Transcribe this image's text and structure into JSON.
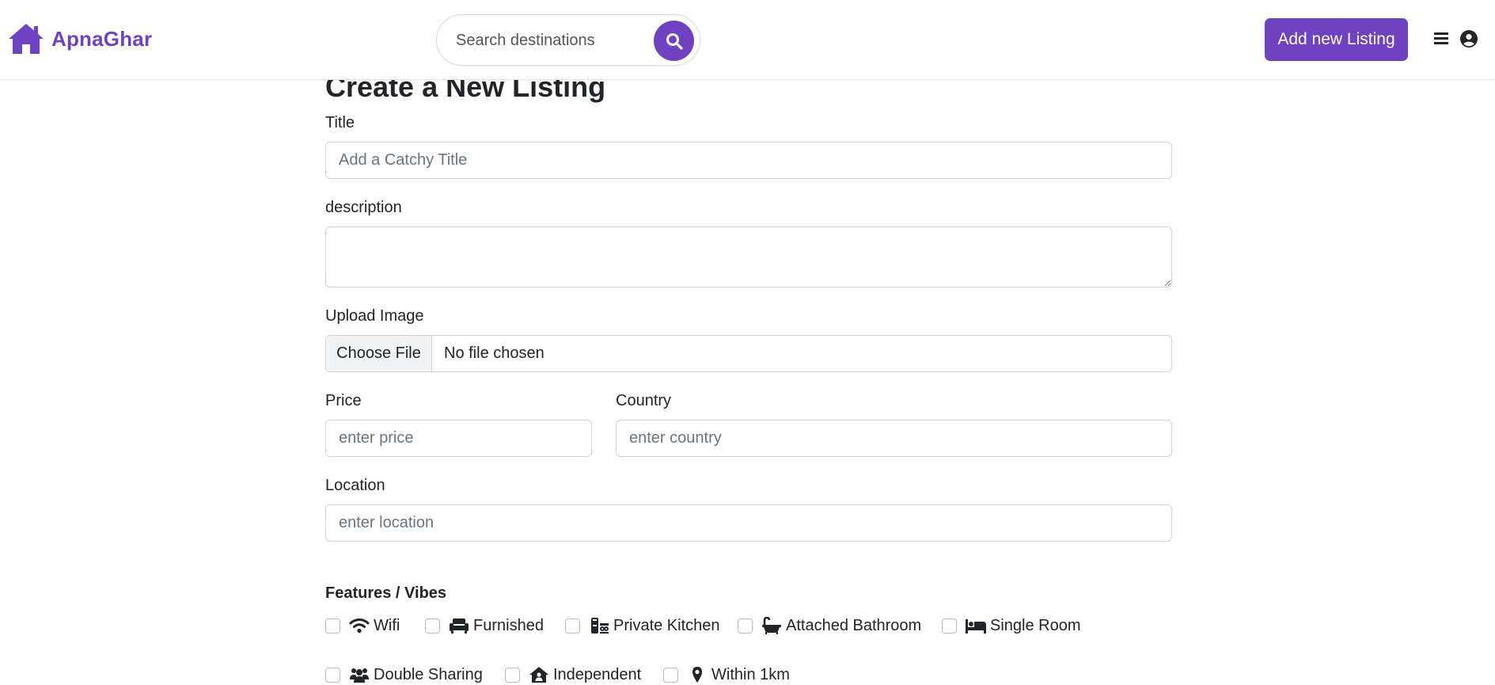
{
  "header": {
    "brand_name": "ApnaGhar",
    "brand_color": "#6f42c1",
    "search_placeholder": "Search destinations",
    "add_listing_label": "Add new Listing",
    "icons": [
      "house-icon",
      "search-icon",
      "hamburger-menu-icon",
      "user-circle-icon"
    ]
  },
  "form": {
    "heading": "Create a New Listing",
    "title_label": "Title",
    "title_placeholder": "Add a Catchy Title",
    "description_label": "description",
    "description_value": "",
    "image_label": "Upload Image",
    "file_button_label": "Choose File",
    "file_status": "No file chosen",
    "price_label": "Price",
    "price_placeholder": "enter price",
    "country_label": "Country",
    "country_placeholder": "enter country",
    "location_label": "Location",
    "location_placeholder": "enter location"
  },
  "features": {
    "heading": "Features / Vibes",
    "items": [
      {
        "label": "Wifi",
        "icon": "wifi-icon",
        "checked": false
      },
      {
        "label": "Furnished",
        "icon": "couch-icon",
        "checked": false
      },
      {
        "label": "Private Kitchen",
        "icon": "kitchen-icon",
        "checked": false
      },
      {
        "label": "Attached Bathroom",
        "icon": "bath-icon",
        "checked": false
      },
      {
        "label": "Single Room",
        "icon": "bed-icon",
        "checked": false
      },
      {
        "label": "Double Sharing",
        "icon": "users-icon",
        "checked": false
      },
      {
        "label": "Independent",
        "icon": "house-user-icon",
        "checked": false
      },
      {
        "label": "Within 1km",
        "icon": "map-pin-icon",
        "checked": false
      }
    ]
  }
}
